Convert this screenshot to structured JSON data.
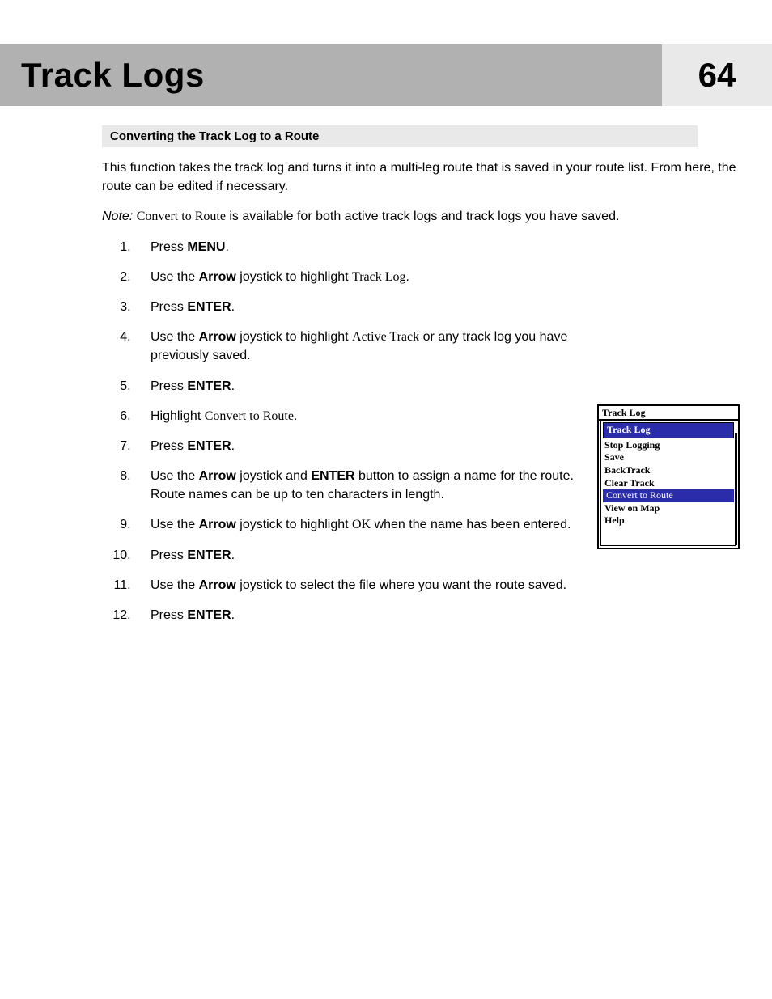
{
  "header": {
    "chapter_title": "Track Logs",
    "page_number": "64"
  },
  "section": {
    "title": "Converting the Track Log to a Route"
  },
  "intro": "This function takes the track log and turns it into a multi-leg route that is saved in your route list.  From here, the route can be edited if necessary.",
  "note": {
    "label": "Note:",
    "prefix_ui": "Convert to Route",
    "rest": " is available for both active track logs and track logs you have saved."
  },
  "steps": [
    {
      "pre": "Press ",
      "bold": "MENU",
      "post": "."
    },
    {
      "pre": "Use the ",
      "bold": "Arrow",
      "mid": " joystick to highlight ",
      "ui": "Track Log",
      "post": "."
    },
    {
      "pre": "Press ",
      "bold": "ENTER",
      "post": "."
    },
    {
      "pre": "Use the ",
      "bold": "Arrow",
      "mid": " joystick to highlight ",
      "ui": "Active Track",
      "post": " or any track log you have previously saved."
    },
    {
      "pre": "Press ",
      "bold": "ENTER",
      "post": "."
    },
    {
      "pre": "Highlight ",
      "ui": "Convert to Route",
      "post": "."
    },
    {
      "pre": "Press ",
      "bold": "ENTER",
      "post": "."
    },
    {
      "pre": "Use the ",
      "bold": "Arrow",
      "mid": " joystick and ",
      "bold2": "ENTER",
      "post": " button to assign a name for the route.  Route names can be up to ten characters in length."
    },
    {
      "pre": "Use the ",
      "bold": "Arrow",
      "mid": " joystick to highlight ",
      "ui": "OK",
      "post": " when the name has been entered."
    },
    {
      "pre": "Press ",
      "bold": "ENTER",
      "post": "."
    },
    {
      "pre": "Use the ",
      "bold": "Arrow",
      "mid": " joystick to select the file where you want the route saved.",
      "post": ""
    },
    {
      "pre": "Press ",
      "bold": "ENTER",
      "post": "."
    }
  ],
  "screenshot": {
    "title_top": "Track Log",
    "title_selected": "Track Log",
    "items": [
      {
        "label": "Stop Logging",
        "hl": false
      },
      {
        "label": "Save",
        "hl": false
      },
      {
        "label": "BackTrack",
        "hl": false
      },
      {
        "label": "Clear Track",
        "hl": false
      },
      {
        "label": "Convert to Route",
        "hl": true
      },
      {
        "label": "View on Map",
        "hl": false
      },
      {
        "label": "Help",
        "hl": false
      }
    ]
  }
}
